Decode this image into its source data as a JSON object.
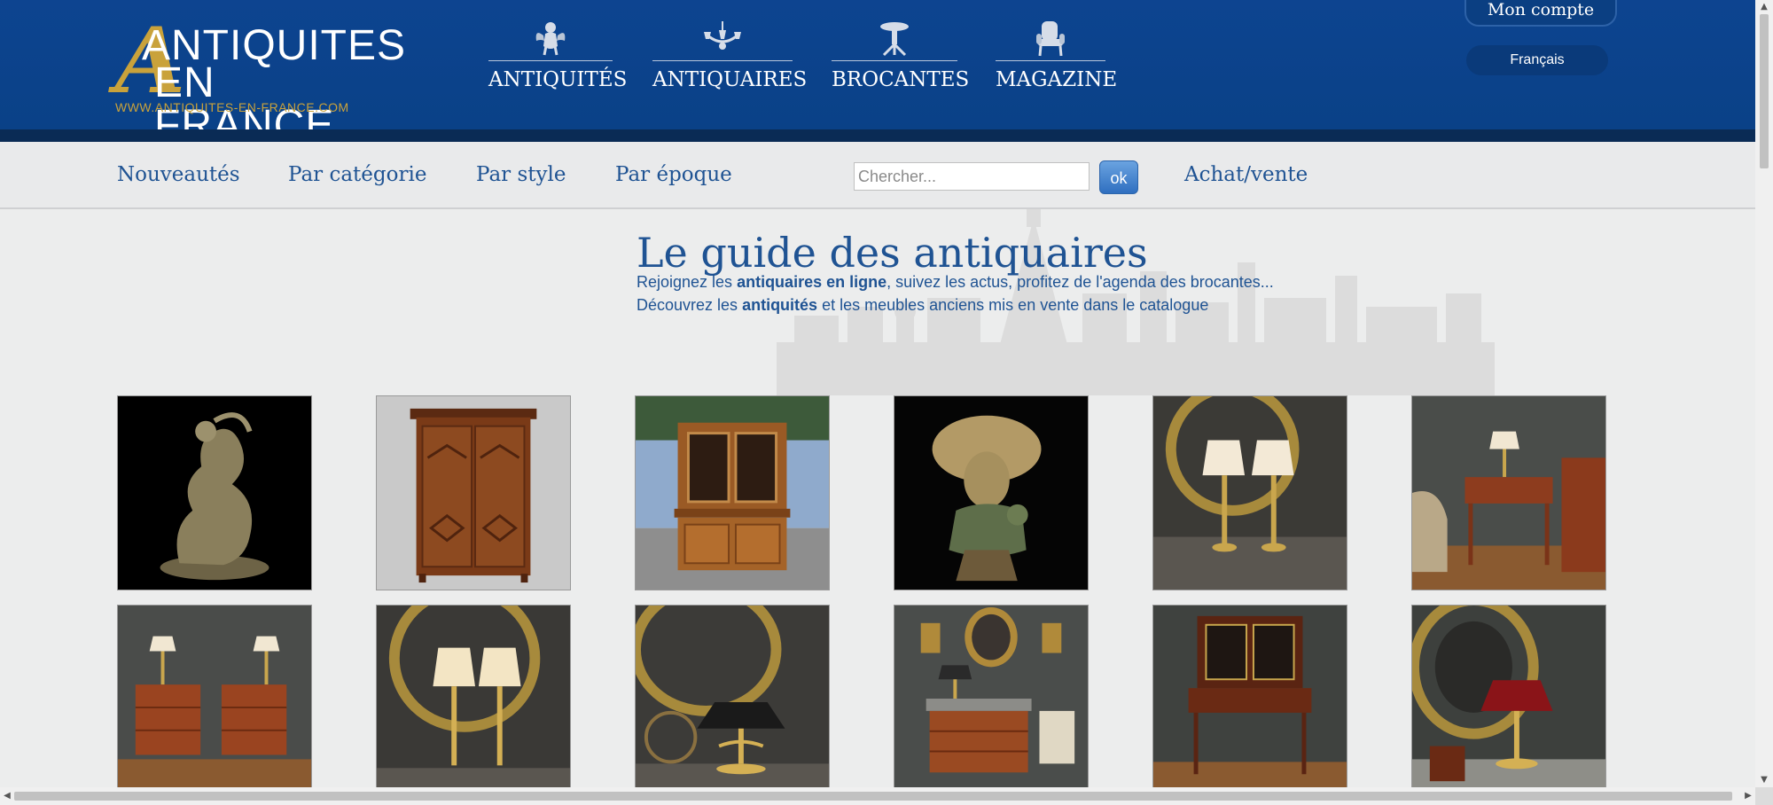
{
  "header": {
    "logo": {
      "line1": "ANTIQUITES",
      "line2": "EN FRANCE",
      "big_letter": "A",
      "url": "WWW.ANTIQUITES-EN-FRANCE.COM"
    },
    "main_nav": [
      {
        "label": "ANTIQUITÉS",
        "icon": "cherub-icon"
      },
      {
        "label": "ANTIQUAIRES",
        "icon": "chandelier-icon"
      },
      {
        "label": "BROCANTES",
        "icon": "pedestal-table-icon"
      },
      {
        "label": "MAGAZINE",
        "icon": "armchair-icon"
      }
    ],
    "account_label": "Mon compte",
    "language_label": "Français"
  },
  "subnav": {
    "links": [
      "Nouveautés",
      "Par catégorie",
      "Par style",
      "Par époque"
    ],
    "search_placeholder": "Chercher...",
    "search_button": "ok",
    "buy_sell_label": "Achat/vente"
  },
  "hero": {
    "title": "Le guide des antiquaires",
    "line1": {
      "before": "Rejoignez les ",
      "bold": "antiquaires en ligne",
      "after": ", suivez les actus, profitez de l'agenda des brocantes..."
    },
    "line2": {
      "before": "Découvrez les ",
      "bold": "antiquités",
      "after": " et les meubles anciens mis en vente dans le catalogue"
    }
  },
  "gallery": [
    {
      "name": "bronze-sculpture",
      "bg": "#000000"
    },
    {
      "name": "walnut-armoire",
      "bg": "#c9c9c9"
    },
    {
      "name": "buffet-deux-corps",
      "bg": "#7f9fbf"
    },
    {
      "name": "bronze-bust",
      "bg": "#050505"
    },
    {
      "name": "pair-of-lamps",
      "bg": "#3b3a36"
    },
    {
      "name": "writing-table",
      "bg": "#4a4d4a"
    },
    {
      "name": "pair-of-nightstands",
      "bg": "#4a4c4a"
    },
    {
      "name": "brass-lamps",
      "bg": "#3a3936"
    },
    {
      "name": "bouillotte-lamp",
      "bg": "#3c3b38"
    },
    {
      "name": "chest-of-drawers",
      "bg": "#4a4d4b"
    },
    {
      "name": "bonheur-du-jour-desk",
      "bg": "#3f423f"
    },
    {
      "name": "red-shade-lamp",
      "bg": "#3d403d"
    }
  ],
  "colors": {
    "header_blue": "#0d4490",
    "gold": "#c9a23b",
    "link_blue": "#1f5393"
  }
}
